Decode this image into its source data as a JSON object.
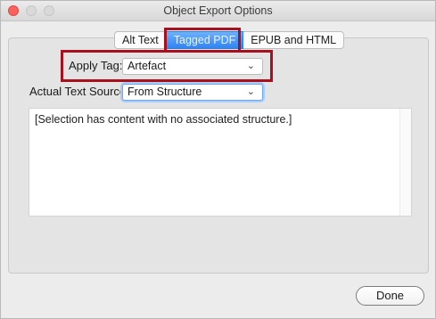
{
  "window": {
    "title": "Object Export Options"
  },
  "tabs": [
    {
      "label": "Alt Text",
      "active": false
    },
    {
      "label": "Tagged PDF",
      "active": true
    },
    {
      "label": "EPUB and HTML",
      "active": false
    }
  ],
  "apply_tag": {
    "label": "Apply Tag:",
    "value": "Artefact"
  },
  "actual_text_source": {
    "label": "Actual Text Source:",
    "value": "From Structure"
  },
  "text_content": "[Selection has content with no associated structure.]",
  "done_label": "Done",
  "colors": {
    "highlight_box": "#a8101d",
    "active_tab": "#2f84f4",
    "close_button": "#fc605c"
  },
  "icons": {
    "dropdown": "chevron-down-icon"
  }
}
